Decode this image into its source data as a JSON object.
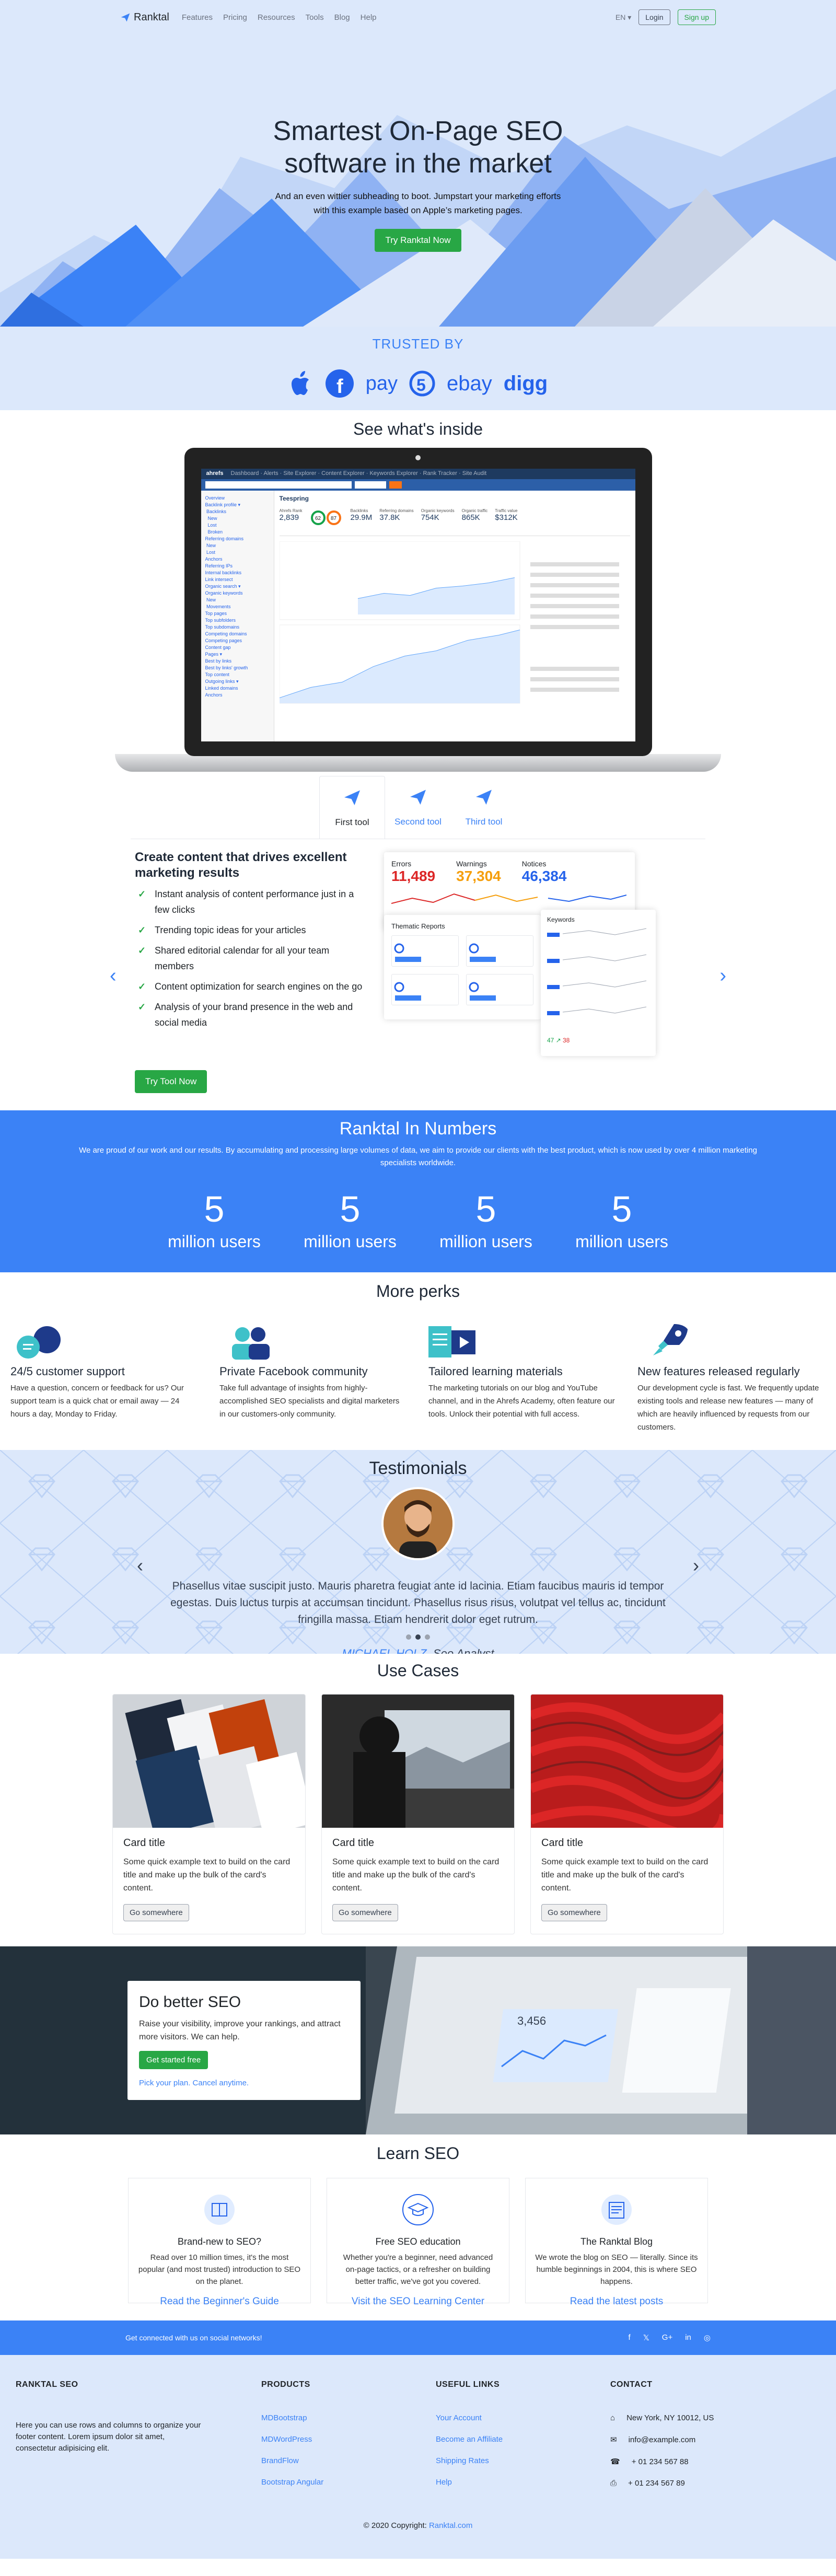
{
  "nav": {
    "brand": "Ranktal",
    "links": [
      "Features",
      "Pricing",
      "Resources",
      "Tools",
      "Blog",
      "Help"
    ],
    "lang": "EN",
    "login": "Login",
    "signup": "Sign up"
  },
  "hero": {
    "title_line1": "Smartest On-Page SEO",
    "title_line2": "software in the market",
    "subtitle_line1": "And an even wittier subheading to boot. Jumpstart your marketing efforts",
    "subtitle_line2": "with this example based on Apple’s marketing pages.",
    "cta": "Try Ranktal Now"
  },
  "trusted": {
    "title": "TRUSTED BY",
    "logos": [
      "apple-icon",
      "facebook-icon",
      "pay-logo",
      "5-logo",
      "ebay",
      "digg"
    ],
    "ebay": "ebay",
    "digg": "digg",
    "pay": "pay"
  },
  "inside": {
    "title": "See what's inside",
    "tabs": [
      "First tool",
      "Second tool",
      "Third tool"
    ],
    "tool": {
      "heading": "Create content that drives excellent marketing results",
      "items": [
        "Instant analysis of content performance just in a few clicks",
        "Trending topic ideas for your articles",
        "Shared editorial calendar for all your team members",
        "Content optimization for search engines on the go",
        "Analysis of your brand presence in the web and social media"
      ],
      "cta": "Try Tool Now"
    },
    "dashboard": {
      "errors_label": "Errors",
      "errors": "11,489",
      "warnings_label": "Warnings",
      "warnings": "37,304",
      "notices_label": "Notices",
      "notices": "46,384",
      "thematic": "Thematic Reports",
      "keywords": "Keywords"
    },
    "screen": {
      "brand": "ahrefs",
      "site": "Teespring",
      "metrics": [
        {
          "label": "Ahrefs Rank",
          "value": "2,839"
        },
        {
          "label": "Backlinks",
          "value": "29.9M"
        },
        {
          "label": "Referring domains",
          "value": "37.8K"
        },
        {
          "label": "Organic keywords",
          "value": "754K"
        },
        {
          "label": "Organic traffic",
          "value": "865K"
        },
        {
          "label": "Traffic value",
          "value": "$312K"
        }
      ]
    }
  },
  "numbers": {
    "title": "Ranktal In Numbers",
    "text": "We are proud of our work and our results. By accumulating and processing large volumes of data, we aim to provide our clients with the best product, which is now used by over 4 million marketing specialists worldwide.",
    "stats": [
      {
        "n": "5",
        "u": "million users"
      },
      {
        "n": "5",
        "u": "million users"
      },
      {
        "n": "5",
        "u": "million users"
      },
      {
        "n": "5",
        "u": "million users"
      }
    ]
  },
  "perks": {
    "title": "More perks",
    "items": [
      {
        "title": "24/5 customer support",
        "text": "Have a question, concern or feedback for us? Our support team is a quick chat or email away — 24 hours a day, Monday to Friday."
      },
      {
        "title": "Private Facebook community",
        "text": "Take full advantage of insights from highly-accomplished SEO specialists and digital marketers in our customers-only community."
      },
      {
        "title": "Tailored learning materials",
        "text": "The marketing tutorials on our blog and YouTube channel, and in the Ahrefs Academy, often feature our tools. Unlock their potential with full access."
      },
      {
        "title": "New features released regularly",
        "text": "Our development cycle is fast. We frequently update existing tools and release new features — many of which are heavily influenced by requests from our customers."
      }
    ]
  },
  "testimonials": {
    "title": "Testimonials",
    "quote": "Phasellus vitae suscipit justo. Mauris pharetra feugiat ante id lacinia. Etiam faucibus mauris id tempor egestas. Duis luctus turpis at accumsan tincidunt. Phasellus risus risus, volutpat vel tellus ac, tincidunt fringilla massa. Etiam hendrerit dolor eget rutrum.",
    "name": "MICHAEL HOLZ",
    "role": ", Seo Analyst"
  },
  "uses": {
    "title": "Use Cases",
    "cards": [
      {
        "title": "Card title",
        "text": "Some quick example text to build on the card title and make up the bulk of the card's content.",
        "btn": "Go somewhere"
      },
      {
        "title": "Card title",
        "text": "Some quick example text to build on the card title and make up the bulk of the card's content.",
        "btn": "Go somewhere"
      },
      {
        "title": "Card title",
        "text": "Some quick example text to build on the card title and make up the bulk of the card's content.",
        "btn": "Go somewhere"
      }
    ]
  },
  "promo": {
    "title": "Do better SEO",
    "text": "Raise your visibility, improve your rankings, and attract more visitors. We can help.",
    "cta": "Get started free",
    "link": "Pick your plan. Cancel anytime.",
    "big_number": "3,456"
  },
  "learn": {
    "title": "Learn SEO",
    "cards": [
      {
        "title": "Brand-new to SEO?",
        "text": "Read over 10 million times, it's the most popular (and most trusted) introduction to SEO on the planet.",
        "link": "Read the Beginner's Guide"
      },
      {
        "title": "Free SEO education",
        "text": "Whether you're a beginner, need advanced on-page tactics, or a refresher on building better traffic, we've got you covered.",
        "link": "Visit the SEO Learning Center"
      },
      {
        "title": "The Ranktal Blog",
        "text": "We wrote the blog on SEO — literally. Since its humble beginnings in 2004, this is where SEO happens.",
        "link": "Read the latest posts"
      }
    ]
  },
  "social": {
    "text": "Get connected with us on social networks!",
    "icons": [
      "f",
      "𝕏",
      "G+",
      "in",
      "◎"
    ]
  },
  "footer": {
    "col1_title": "RANKTAL SEO",
    "col1_text": "Here you can use rows and columns to organize your footer content. Lorem ipsum dolor sit amet, consectetur adipisicing elit.",
    "col2_title": "PRODUCTS",
    "products": [
      "MDBootstrap",
      "MDWordPress",
      "BrandFlow",
      "Bootstrap Angular"
    ],
    "col3_title": "USEFUL LINKS",
    "links": [
      "Your Account",
      "Become an Affiliate",
      "Shipping Rates",
      "Help"
    ],
    "col4_title": "CONTACT",
    "contact": [
      "New York, NY 10012, US",
      "info@example.com",
      "+ 01 234 567 88",
      "+ 01 234 567 89"
    ],
    "copyright": "© 2020 Copyright: ",
    "copyright_link": "Ranktal.com"
  },
  "colors": {
    "accent": "#3b82f6",
    "green": "#28a745",
    "lightbg": "#dce8fb"
  }
}
